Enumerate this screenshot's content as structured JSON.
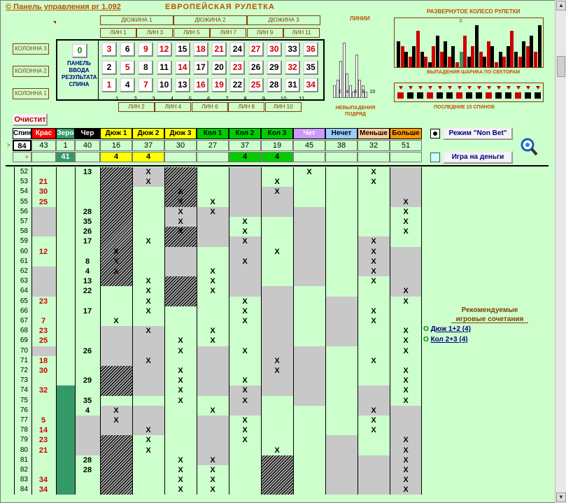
{
  "app": {
    "title": "© Панель управления  рг 1.092",
    "subtitle": "ЕВРОПЕЙСКАЯ  РУЛЕТКА"
  },
  "dozens": [
    "ДЮЖИНА 1",
    "ДЮЖИНА 2",
    "ДЮЖИНА 3"
  ],
  "lines_top": [
    "ЛИН 1",
    "ЛИН 3",
    "ЛИН 5",
    "ЛИН 7",
    "ЛИН 9",
    "ЛИН 11"
  ],
  "lines_bottom": [
    "ЛИН 2",
    "ЛИН 4",
    "ЛИН 6",
    "ЛИН 8",
    "ЛИН 10"
  ],
  "columns": [
    "КОЛОННА 3",
    "КОЛОННА 2",
    "КОЛОННА 1"
  ],
  "panel_label": "ПАНЕЛЬ ВВОДА РЕЗУЛЬТАТА СПИНА",
  "zero": "0",
  "numbers": [
    [
      {
        "n": "3",
        "c": "red"
      },
      {
        "n": "6",
        "c": "blk"
      },
      {
        "n": "9",
        "c": "red"
      },
      {
        "n": "12",
        "c": "red"
      },
      {
        "n": "15",
        "c": "blk"
      },
      {
        "n": "18",
        "c": "red"
      },
      {
        "n": "21",
        "c": "red"
      },
      {
        "n": "24",
        "c": "blk"
      },
      {
        "n": "27",
        "c": "red"
      },
      {
        "n": "30",
        "c": "red"
      },
      {
        "n": "33",
        "c": "blk"
      },
      {
        "n": "36",
        "c": "red"
      }
    ],
    [
      {
        "n": "2",
        "c": "blk"
      },
      {
        "n": "5",
        "c": "red"
      },
      {
        "n": "8",
        "c": "blk"
      },
      {
        "n": "11",
        "c": "blk"
      },
      {
        "n": "14",
        "c": "red"
      },
      {
        "n": "17",
        "c": "blk"
      },
      {
        "n": "20",
        "c": "blk"
      },
      {
        "n": "23",
        "c": "red"
      },
      {
        "n": "26",
        "c": "blk"
      },
      {
        "n": "29",
        "c": "blk"
      },
      {
        "n": "32",
        "c": "red"
      },
      {
        "n": "35",
        "c": "blk"
      }
    ],
    [
      {
        "n": "1",
        "c": "red"
      },
      {
        "n": "4",
        "c": "blk"
      },
      {
        "n": "7",
        "c": "red"
      },
      {
        "n": "10",
        "c": "blk"
      },
      {
        "n": "13",
        "c": "blk"
      },
      {
        "n": "16",
        "c": "red"
      },
      {
        "n": "19",
        "c": "red"
      },
      {
        "n": "22",
        "c": "blk"
      },
      {
        "n": "25",
        "c": "red"
      },
      {
        "n": "28",
        "c": "blk"
      },
      {
        "n": "31",
        "c": "blk"
      },
      {
        "n": "34",
        "c": "red"
      }
    ]
  ],
  "line_ticks": [
    "1",
    "2",
    "3",
    "4",
    "5",
    "6",
    "7",
    "8",
    "9",
    "10",
    "11"
  ],
  "charts": {
    "lines_title": "ЛИНИИ",
    "lines_caption": "НЕВЫПАДЕНИЯ ПОДРЯД",
    "lines_ticks": [
      "2",
      "4",
      "6",
      "8",
      "10"
    ],
    "wheel_title": "РАЗВЕРНУТОЕ КОЛЕСО РУЛЕТКИ",
    "wheel_caption": "ВЫПАДЕНИЯ ШАРИКА ПО СЕКТОРАМ",
    "last_title": "ПОСЛЕДНИЕ 15 СПИНОВ",
    "wheel_zero": "0"
  },
  "chart_data": {
    "type": "bar",
    "lines_values": [
      2,
      3,
      6,
      9,
      4,
      2,
      1,
      7,
      3,
      2,
      1
    ],
    "wheel_values": [
      5,
      4,
      3,
      2,
      4,
      7,
      3,
      2,
      1,
      4,
      6,
      3,
      5,
      2,
      4,
      1,
      3,
      6,
      2,
      4,
      8,
      3,
      2,
      5,
      4,
      1,
      3,
      2,
      4,
      7,
      3,
      2,
      5,
      4,
      6,
      3,
      8
    ]
  },
  "clear_button": "Очистит",
  "headers": [
    {
      "label": "Спин",
      "bg": "#ffffff",
      "fg": "#000000"
    },
    {
      "label": "Крас",
      "bg": "#ff0000",
      "fg": "#ffffff"
    },
    {
      "label": "Зеро",
      "bg": "#339966",
      "fg": "#ffffff"
    },
    {
      "label": "Чер",
      "bg": "#000000",
      "fg": "#ffffff"
    },
    {
      "label": "Дюж 1",
      "bg": "#ffff00",
      "fg": "#000000"
    },
    {
      "label": "Дюж 2",
      "bg": "#ffff00",
      "fg": "#000000"
    },
    {
      "label": "Дюж 3",
      "bg": "#ffff00",
      "fg": "#000000"
    },
    {
      "label": "Кол 1",
      "bg": "#00cc00",
      "fg": "#000000"
    },
    {
      "label": "Кол 2",
      "bg": "#00cc00",
      "fg": "#000000"
    },
    {
      "label": "Кол 3",
      "bg": "#00cc00",
      "fg": "#000000"
    },
    {
      "label": "Чет",
      "bg": "#cc99ff",
      "fg": "#ffffff"
    },
    {
      "label": "Нечет",
      "bg": "#99ccff",
      "fg": "#000000"
    },
    {
      "label": "Меньше",
      "bg": "#ffcc99",
      "fg": "#000000"
    },
    {
      "label": "Больше",
      "bg": "#ff9900",
      "fg": "#000000"
    }
  ],
  "values": [
    "84",
    "43",
    "1",
    "40",
    "16",
    "37",
    "30",
    "27",
    "37",
    "19",
    "45",
    "38",
    "32",
    "51"
  ],
  "values2": [
    "",
    "",
    "41",
    "",
    "4",
    "4",
    "",
    "",
    "4",
    "4",
    "",
    "",
    "",
    ""
  ],
  "mode_button": "Режим \"Non Bet\"",
  "money_button": "Игра на деньги",
  "recommend": {
    "title": "Рекомендуемые игровые сочетания",
    "items": [
      "Дюж 1+2 (4)",
      "Кол 2+3 (4)"
    ]
  },
  "rows": [
    {
      "n": "52",
      "v": "13",
      "c": "blk",
      "x": [
        0,
        1,
        0,
        0,
        0,
        0,
        1,
        0,
        1,
        0
      ]
    },
    {
      "n": "53",
      "v": "21",
      "c": "red",
      "x": [
        0,
        1,
        0,
        0,
        0,
        1,
        0,
        0,
        1,
        0
      ]
    },
    {
      "n": "54",
      "v": "30",
      "c": "red",
      "x": [
        0,
        0,
        1,
        0,
        0,
        1,
        0,
        0,
        0,
        0
      ]
    },
    {
      "n": "55",
      "v": "25",
      "c": "red",
      "x": [
        0,
        0,
        1,
        1,
        0,
        0,
        0,
        0,
        0,
        1
      ]
    },
    {
      "n": "56",
      "v": "28",
      "c": "blk",
      "x": [
        0,
        0,
        1,
        1,
        0,
        0,
        0,
        0,
        0,
        1
      ]
    },
    {
      "n": "57",
      "v": "35",
      "c": "blk",
      "x": [
        0,
        0,
        1,
        0,
        1,
        0,
        0,
        0,
        0,
        1
      ]
    },
    {
      "n": "58",
      "v": "26",
      "c": "blk",
      "x": [
        0,
        0,
        1,
        0,
        1,
        0,
        0,
        0,
        0,
        1
      ]
    },
    {
      "n": "59",
      "v": "17",
      "c": "blk",
      "x": [
        0,
        1,
        0,
        0,
        1,
        0,
        0,
        0,
        1,
        0
      ]
    },
    {
      "n": "60",
      "v": "12",
      "c": "red",
      "x": [
        1,
        0,
        0,
        0,
        0,
        1,
        0,
        0,
        1,
        0
      ]
    },
    {
      "n": "61",
      "v": "8",
      "c": "blk",
      "x": [
        1,
        0,
        0,
        0,
        1,
        0,
        0,
        0,
        1,
        0
      ]
    },
    {
      "n": "62",
      "v": "4",
      "c": "blk",
      "x": [
        1,
        0,
        0,
        1,
        0,
        0,
        0,
        0,
        1,
        0
      ]
    },
    {
      "n": "63",
      "v": "13",
      "c": "blk",
      "x": [
        0,
        1,
        0,
        1,
        0,
        0,
        0,
        0,
        1,
        0
      ]
    },
    {
      "n": "64",
      "v": "22",
      "c": "blk",
      "x": [
        0,
        1,
        0,
        1,
        0,
        0,
        0,
        0,
        0,
        1
      ]
    },
    {
      "n": "65",
      "v": "23",
      "c": "red",
      "x": [
        0,
        1,
        0,
        0,
        1,
        0,
        0,
        0,
        0,
        1
      ]
    },
    {
      "n": "66",
      "v": "17",
      "c": "blk",
      "x": [
        0,
        1,
        0,
        0,
        1,
        0,
        0,
        0,
        1,
        0
      ]
    },
    {
      "n": "67",
      "v": "7",
      "c": "red",
      "x": [
        1,
        0,
        0,
        0,
        1,
        0,
        0,
        0,
        1,
        0
      ]
    },
    {
      "n": "68",
      "v": "23",
      "c": "red",
      "x": [
        0,
        1,
        0,
        1,
        0,
        0,
        0,
        0,
        0,
        1
      ]
    },
    {
      "n": "69",
      "v": "25",
      "c": "red",
      "x": [
        0,
        0,
        1,
        1,
        0,
        0,
        0,
        0,
        0,
        1
      ]
    },
    {
      "n": "70",
      "v": "26",
      "c": "blk",
      "x": [
        0,
        0,
        1,
        0,
        1,
        0,
        0,
        0,
        0,
        1
      ]
    },
    {
      "n": "71",
      "v": "18",
      "c": "red",
      "x": [
        0,
        1,
        0,
        0,
        0,
        1,
        0,
        0,
        1,
        0
      ]
    },
    {
      "n": "72",
      "v": "30",
      "c": "red",
      "x": [
        0,
        0,
        1,
        0,
        0,
        1,
        0,
        0,
        0,
        1
      ]
    },
    {
      "n": "73",
      "v": "29",
      "c": "blk",
      "x": [
        0,
        0,
        1,
        0,
        1,
        0,
        0,
        0,
        0,
        1
      ]
    },
    {
      "n": "74",
      "v": "32",
      "c": "red",
      "x": [
        0,
        0,
        1,
        0,
        1,
        0,
        0,
        0,
        0,
        1
      ]
    },
    {
      "n": "75",
      "v": "35",
      "c": "blk",
      "x": [
        0,
        0,
        1,
        0,
        1,
        0,
        0,
        0,
        0,
        1
      ]
    },
    {
      "n": "76",
      "v": "4",
      "c": "blk",
      "x": [
        1,
        0,
        0,
        1,
        0,
        0,
        0,
        0,
        1,
        0
      ]
    },
    {
      "n": "77",
      "v": "5",
      "c": "red",
      "x": [
        1,
        0,
        0,
        0,
        1,
        0,
        0,
        0,
        1,
        0
      ]
    },
    {
      "n": "78",
      "v": "14",
      "c": "red",
      "x": [
        0,
        1,
        0,
        0,
        1,
        0,
        0,
        0,
        1,
        0
      ]
    },
    {
      "n": "79",
      "v": "23",
      "c": "red",
      "x": [
        0,
        1,
        0,
        0,
        1,
        0,
        0,
        0,
        0,
        1
      ]
    },
    {
      "n": "80",
      "v": "21",
      "c": "red",
      "x": [
        0,
        1,
        0,
        0,
        0,
        1,
        0,
        0,
        0,
        1
      ]
    },
    {
      "n": "81",
      "v": "28",
      "c": "blk",
      "x": [
        0,
        0,
        1,
        1,
        0,
        0,
        0,
        0,
        0,
        1
      ]
    },
    {
      "n": "82",
      "v": "28",
      "c": "blk",
      "x": [
        0,
        0,
        1,
        1,
        0,
        0,
        0,
        0,
        0,
        1
      ]
    },
    {
      "n": "83",
      "v": "34",
      "c": "red",
      "x": [
        0,
        0,
        1,
        1,
        0,
        0,
        0,
        0,
        0,
        1
      ]
    },
    {
      "n": "84",
      "v": "34",
      "c": "red",
      "x": [
        0,
        0,
        1,
        1,
        0,
        0,
        0,
        0,
        0,
        1
      ]
    }
  ],
  "xmark": "X"
}
